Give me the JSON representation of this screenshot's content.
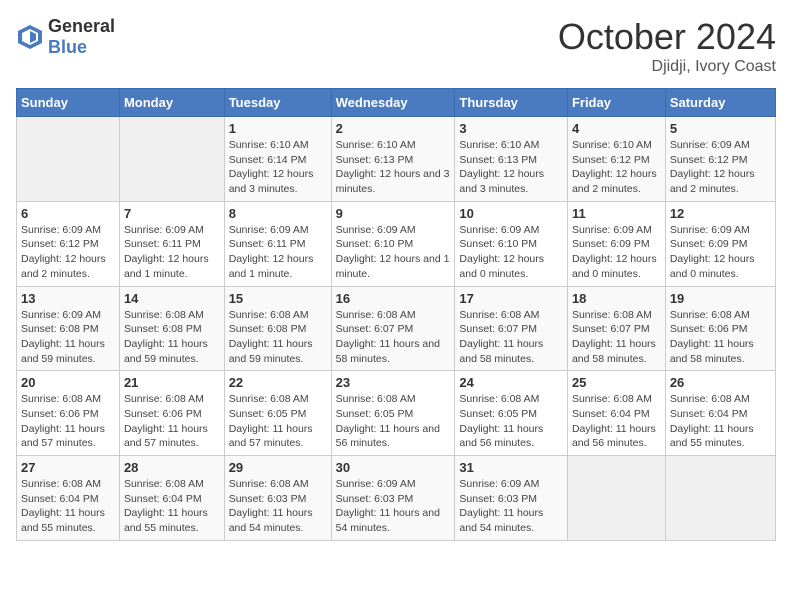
{
  "header": {
    "logo": {
      "general": "General",
      "blue": "Blue"
    },
    "title": "October 2024",
    "location": "Djidji, Ivory Coast"
  },
  "weekdays": [
    "Sunday",
    "Monday",
    "Tuesday",
    "Wednesday",
    "Thursday",
    "Friday",
    "Saturday"
  ],
  "weeks": [
    [
      {
        "day": "",
        "detail": ""
      },
      {
        "day": "",
        "detail": ""
      },
      {
        "day": "1",
        "detail": "Sunrise: 6:10 AM\nSunset: 6:14 PM\nDaylight: 12 hours and 3 minutes."
      },
      {
        "day": "2",
        "detail": "Sunrise: 6:10 AM\nSunset: 6:13 PM\nDaylight: 12 hours and 3 minutes."
      },
      {
        "day": "3",
        "detail": "Sunrise: 6:10 AM\nSunset: 6:13 PM\nDaylight: 12 hours and 3 minutes."
      },
      {
        "day": "4",
        "detail": "Sunrise: 6:10 AM\nSunset: 6:12 PM\nDaylight: 12 hours and 2 minutes."
      },
      {
        "day": "5",
        "detail": "Sunrise: 6:09 AM\nSunset: 6:12 PM\nDaylight: 12 hours and 2 minutes."
      }
    ],
    [
      {
        "day": "6",
        "detail": "Sunrise: 6:09 AM\nSunset: 6:12 PM\nDaylight: 12 hours and 2 minutes."
      },
      {
        "day": "7",
        "detail": "Sunrise: 6:09 AM\nSunset: 6:11 PM\nDaylight: 12 hours and 1 minute."
      },
      {
        "day": "8",
        "detail": "Sunrise: 6:09 AM\nSunset: 6:11 PM\nDaylight: 12 hours and 1 minute."
      },
      {
        "day": "9",
        "detail": "Sunrise: 6:09 AM\nSunset: 6:10 PM\nDaylight: 12 hours and 1 minute."
      },
      {
        "day": "10",
        "detail": "Sunrise: 6:09 AM\nSunset: 6:10 PM\nDaylight: 12 hours and 0 minutes."
      },
      {
        "day": "11",
        "detail": "Sunrise: 6:09 AM\nSunset: 6:09 PM\nDaylight: 12 hours and 0 minutes."
      },
      {
        "day": "12",
        "detail": "Sunrise: 6:09 AM\nSunset: 6:09 PM\nDaylight: 12 hours and 0 minutes."
      }
    ],
    [
      {
        "day": "13",
        "detail": "Sunrise: 6:09 AM\nSunset: 6:08 PM\nDaylight: 11 hours and 59 minutes."
      },
      {
        "day": "14",
        "detail": "Sunrise: 6:08 AM\nSunset: 6:08 PM\nDaylight: 11 hours and 59 minutes."
      },
      {
        "day": "15",
        "detail": "Sunrise: 6:08 AM\nSunset: 6:08 PM\nDaylight: 11 hours and 59 minutes."
      },
      {
        "day": "16",
        "detail": "Sunrise: 6:08 AM\nSunset: 6:07 PM\nDaylight: 11 hours and 58 minutes."
      },
      {
        "day": "17",
        "detail": "Sunrise: 6:08 AM\nSunset: 6:07 PM\nDaylight: 11 hours and 58 minutes."
      },
      {
        "day": "18",
        "detail": "Sunrise: 6:08 AM\nSunset: 6:07 PM\nDaylight: 11 hours and 58 minutes."
      },
      {
        "day": "19",
        "detail": "Sunrise: 6:08 AM\nSunset: 6:06 PM\nDaylight: 11 hours and 58 minutes."
      }
    ],
    [
      {
        "day": "20",
        "detail": "Sunrise: 6:08 AM\nSunset: 6:06 PM\nDaylight: 11 hours and 57 minutes."
      },
      {
        "day": "21",
        "detail": "Sunrise: 6:08 AM\nSunset: 6:06 PM\nDaylight: 11 hours and 57 minutes."
      },
      {
        "day": "22",
        "detail": "Sunrise: 6:08 AM\nSunset: 6:05 PM\nDaylight: 11 hours and 57 minutes."
      },
      {
        "day": "23",
        "detail": "Sunrise: 6:08 AM\nSunset: 6:05 PM\nDaylight: 11 hours and 56 minutes."
      },
      {
        "day": "24",
        "detail": "Sunrise: 6:08 AM\nSunset: 6:05 PM\nDaylight: 11 hours and 56 minutes."
      },
      {
        "day": "25",
        "detail": "Sunrise: 6:08 AM\nSunset: 6:04 PM\nDaylight: 11 hours and 56 minutes."
      },
      {
        "day": "26",
        "detail": "Sunrise: 6:08 AM\nSunset: 6:04 PM\nDaylight: 11 hours and 55 minutes."
      }
    ],
    [
      {
        "day": "27",
        "detail": "Sunrise: 6:08 AM\nSunset: 6:04 PM\nDaylight: 11 hours and 55 minutes."
      },
      {
        "day": "28",
        "detail": "Sunrise: 6:08 AM\nSunset: 6:04 PM\nDaylight: 11 hours and 55 minutes."
      },
      {
        "day": "29",
        "detail": "Sunrise: 6:08 AM\nSunset: 6:03 PM\nDaylight: 11 hours and 54 minutes."
      },
      {
        "day": "30",
        "detail": "Sunrise: 6:09 AM\nSunset: 6:03 PM\nDaylight: 11 hours and 54 minutes."
      },
      {
        "day": "31",
        "detail": "Sunrise: 6:09 AM\nSunset: 6:03 PM\nDaylight: 11 hours and 54 minutes."
      },
      {
        "day": "",
        "detail": ""
      },
      {
        "day": "",
        "detail": ""
      }
    ]
  ]
}
